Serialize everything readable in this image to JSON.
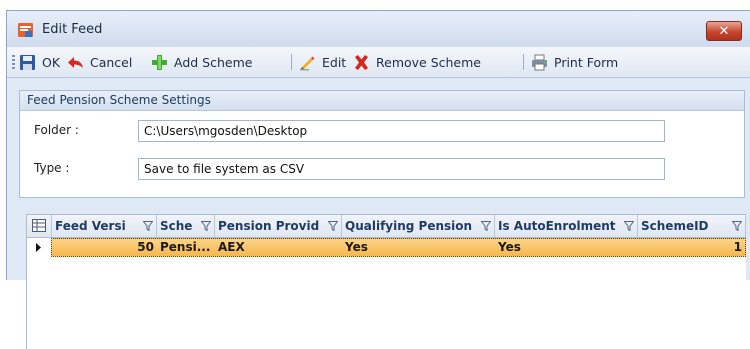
{
  "window": {
    "title": "Edit Feed",
    "close_glyph": "✕"
  },
  "toolbar": {
    "ok_label": "OK",
    "cancel_label": "Cancel",
    "add_scheme_label": "Add Scheme",
    "edit_label": "Edit",
    "remove_scheme_label": "Remove Scheme",
    "print_form_label": "Print Form"
  },
  "settings": {
    "header": "Feed Pension Scheme Settings",
    "folder_label": "Folder :",
    "folder_value": "C:\\Users\\mgosden\\Desktop",
    "type_label": "Type :",
    "type_value": "Save to file system as CSV"
  },
  "grid": {
    "columns": [
      "Feed Versi",
      "Sche",
      "Pension Provid",
      "Qualifying Pension",
      "Is AutoEnrolment",
      "SchemeID"
    ],
    "rows": [
      [
        "50",
        "Pensi...",
        "AEX",
        "Yes",
        "Yes",
        "1"
      ]
    ]
  },
  "colors": {
    "selected_row": "#f6b74c",
    "header_text": "#1f3b66",
    "window_bg": "#dfe8f5"
  },
  "icons": {
    "app": "edit-feed-icon",
    "ok": "save-icon",
    "cancel": "back-arrow-icon",
    "add_scheme": "add-icon",
    "edit": "pencil-icon",
    "remove_scheme": "delete-x-icon",
    "print_form": "print-icon"
  }
}
